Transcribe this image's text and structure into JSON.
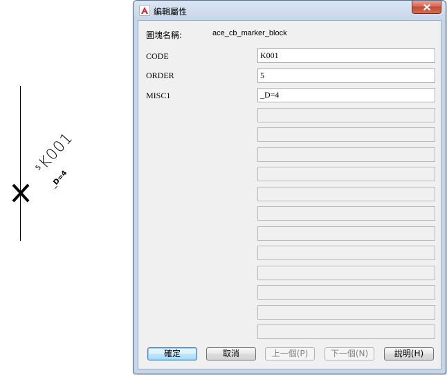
{
  "cad": {
    "code_text": "K001",
    "order_superscript": "5",
    "misc_text": "_D=4"
  },
  "dialog": {
    "title": "編輯屬性",
    "block_name_label": "圖塊名稱:",
    "block_name_value": "ace_cb_marker_block",
    "attributes": [
      {
        "label": "CODE",
        "value": "K001"
      },
      {
        "label": "ORDER",
        "value": "5"
      },
      {
        "label": "MISC1",
        "value": "_D=4"
      }
    ],
    "empty_field_count_note": "",
    "buttons": {
      "ok": "確定",
      "cancel": "取消",
      "previous": "上一個(P)",
      "next": "下一個(N)",
      "help": "說明(H)"
    }
  },
  "colors": {
    "close_button": "#c24a31",
    "app_icon": "#d3202f",
    "titlebar": "#c6d6ea"
  },
  "icons": {
    "app": "autocad-a-icon",
    "close": "close-icon",
    "cad_marker": "cross-marker-icon"
  }
}
